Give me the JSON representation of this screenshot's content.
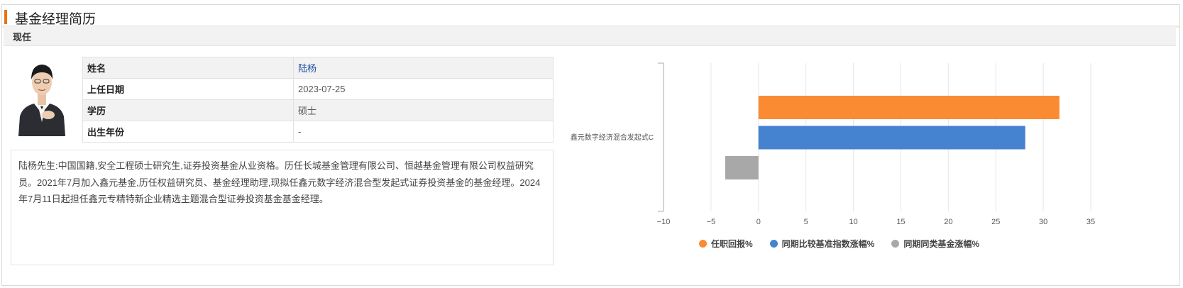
{
  "section_title": "基金经理简历",
  "subheader": "现任",
  "profile": {
    "rows": [
      {
        "label": "姓名",
        "value": "陆杨"
      },
      {
        "label": "上任日期",
        "value": "2023-07-25"
      },
      {
        "label": "学历",
        "value": "硕士"
      },
      {
        "label": "出生年份",
        "value": "-"
      }
    ]
  },
  "bio": "陆杨先生:中国国籍,安全工程硕士研究生,证券投资基金从业资格。历任长城基金管理有限公司、恒越基金管理有限公司权益研究员。2021年7月加入鑫元基金,历任权益研究员、基金经理助理,现拟任鑫元数字经济混合型发起式证券投资基金的基金经理。2024年7月11日起担任鑫元专精特新企业精选主题混合型证券投资基金基金经理。",
  "colors": {
    "accent": "#e8731a",
    "series_orange": "#fb8b33",
    "series_blue": "#4582d0",
    "series_gray": "#a8a8a8",
    "link": "#1a4fa0"
  },
  "chart_data": {
    "type": "bar",
    "orientation": "horizontal",
    "categories": [
      "鑫元数字经济混合发起式C"
    ],
    "series": [
      {
        "name": "任职回报%",
        "values": [
          31.7
        ],
        "color": "#fb8b33"
      },
      {
        "name": "同期比较基准指数涨幅%",
        "values": [
          28.1
        ],
        "color": "#4582d0"
      },
      {
        "name": "同期同类基金涨幅%",
        "values": [
          -3.5
        ],
        "color": "#a8a8a8"
      }
    ],
    "xlim": [
      -10,
      35
    ],
    "xticks": [
      "−10",
      "−5",
      "0",
      "5",
      "10",
      "15",
      "20",
      "25",
      "30",
      "35"
    ],
    "grid": true,
    "legend": "bottom"
  }
}
